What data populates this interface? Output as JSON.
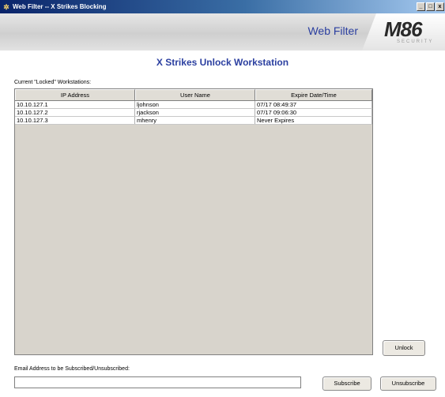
{
  "window": {
    "title": "Web Filter -- X Strikes Blocking",
    "buttons": {
      "minimize": "_",
      "maximize": "□",
      "close": "x"
    }
  },
  "header": {
    "product_title": "Web Filter",
    "logo_main": "M86",
    "logo_sub": "SECURITY"
  },
  "main": {
    "page_title": "X Strikes Unlock Workstation",
    "locked_label": "Current \"Locked\" Workstations:",
    "table": {
      "columns": [
        "IP Address",
        "User Name",
        "Expire Date/Time"
      ],
      "rows": [
        [
          "10.10.127.1",
          "ljohnson",
          "07/17 08:49:37"
        ],
        [
          "10.10.127.2",
          "rjackson",
          "07/17 09:06:30"
        ],
        [
          "10.10.127.3",
          "mhenry",
          "Never Expires"
        ]
      ]
    },
    "unlock_button": "Unlock",
    "email": {
      "label": "Email Address to be Subscribed/Unsubscribed:",
      "value": "",
      "subscribe_button": "Subscribe",
      "unsubscribe_button": "Unsubscribe"
    }
  },
  "colors": {
    "accent": "#2b3fa0",
    "titlebar": "#0a246a",
    "table_bg": "#d8d4cc"
  },
  "icons": {
    "app_icon": "web-filter-app-icon"
  }
}
